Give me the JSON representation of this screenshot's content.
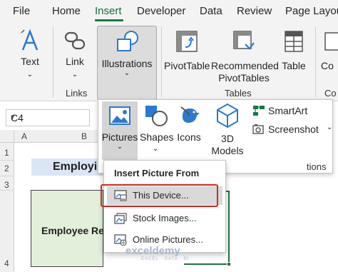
{
  "menu": {
    "tabs": [
      {
        "label": "File"
      },
      {
        "label": "Home"
      },
      {
        "label": "Insert",
        "active": true
      },
      {
        "label": "Developer"
      },
      {
        "label": "Data"
      },
      {
        "label": "Review"
      },
      {
        "label": "Page Layout"
      }
    ]
  },
  "ribbon": {
    "text_label": "Text",
    "link_label": "Link",
    "links_group_label": "Links",
    "illustrations_label": "Illustrations",
    "pivottable_label": "PivotTable",
    "recommended_line1": "Recommended",
    "recommended_line2": "PivotTables",
    "table_label": "Table",
    "tables_group_label": "Tables",
    "partial_label": "Co",
    "partial_group": "Co",
    "accent_color": "#107c41"
  },
  "sheet": {
    "name_box": "C4",
    "col_headers": [
      "A",
      "B"
    ],
    "row_headers": [
      "1",
      "2",
      "3",
      "4"
    ],
    "title_text": "Employi",
    "box_text": "Employee Re"
  },
  "gallery": {
    "pictures_label": "Pictures",
    "shapes_label": "Shapes",
    "icons_label": "Icons",
    "models_line1": "3D",
    "models_line2": "Models",
    "smartart_label": "SmartArt",
    "screenshot_label": "Screenshot",
    "group_label_partial": "tions"
  },
  "dropdown": {
    "title": "Insert Picture From",
    "items": [
      {
        "label": "This Device...",
        "icon": "device-picture-icon",
        "selected": true
      },
      {
        "label": "Stock Images...",
        "icon": "stock-images-icon"
      },
      {
        "label": "Online Pictures...",
        "icon": "online-pictures-icon"
      }
    ],
    "highlight_color": "#d9251d"
  },
  "watermark": {
    "name": "exceldemy",
    "tagline": "EXCEL · DATA · BI"
  }
}
